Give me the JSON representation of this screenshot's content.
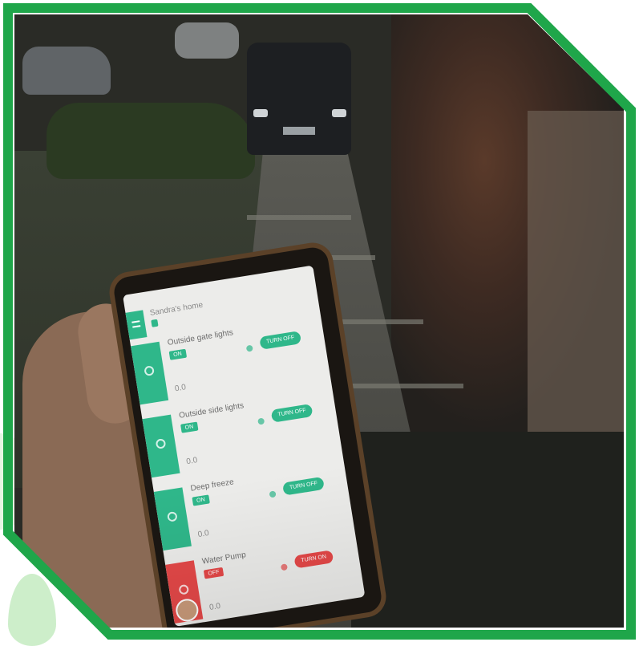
{
  "colors": {
    "frame_green": "#1fa64a",
    "app_green": "#2fb78a",
    "app_red": "#e44848"
  },
  "app": {
    "home_title": "Sandra's home",
    "home_badge": "",
    "menu_icon": "menu-icon"
  },
  "devices": [
    {
      "name": "Outside gate lights",
      "tag": "ON",
      "toggle": "TURN OFF",
      "value": "0.0",
      "state": "on"
    },
    {
      "name": "Outside side lights",
      "tag": "ON",
      "toggle": "TURN OFF",
      "value": "0.0",
      "state": "on"
    },
    {
      "name": "Deep freeze",
      "tag": "ON",
      "toggle": "TURN OFF",
      "value": "0.0",
      "state": "on"
    },
    {
      "name": "Water Pump",
      "tag": "OFF",
      "toggle": "TURN ON",
      "value": "0.0",
      "state": "off"
    }
  ]
}
